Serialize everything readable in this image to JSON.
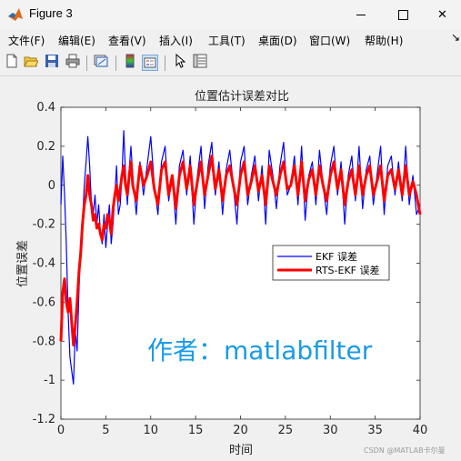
{
  "window": {
    "title": "Figure 3",
    "minimize_glyph": "—",
    "close_glyph": "✕"
  },
  "menu": {
    "items": [
      "文件(F)",
      "编辑(E)",
      "查看(V)",
      "插入(I)",
      "工具(T)",
      "桌面(D)",
      "窗口(W)",
      "帮助(H)"
    ],
    "overflow_glyph": "↘"
  },
  "toolbar": {
    "icons": [
      "new-figure-icon",
      "open-icon",
      "save-icon",
      "print-icon",
      "link-plot-icon",
      "insert-colorbar-icon",
      "insert-legend-icon",
      "edit-plot-cursor-icon",
      "property-inspector-icon"
    ]
  },
  "colors": {
    "ekf": "#0000ff",
    "rts": "#ff0000",
    "watermark": "#1a9be6"
  },
  "chart_data": {
    "type": "line",
    "title": "位置估计误差对比",
    "xlabel": "时间",
    "ylabel": "位置误差",
    "xlim": [
      0,
      40
    ],
    "ylim": [
      -1.2,
      0.4
    ],
    "xticks": [
      "0",
      "5",
      "10",
      "15",
      "20",
      "25",
      "30",
      "35",
      "40"
    ],
    "yticks": [
      "0.4",
      "0.2",
      "0",
      "-0.2",
      "-0.4",
      "-0.6",
      "-0.8",
      "-1",
      "-1.2"
    ],
    "grid": false,
    "legend_position": "right-middle",
    "series": [
      {
        "name": "EKF 误差",
        "color": "#0000ff",
        "x": [
          0,
          0.2,
          0.4,
          0.6,
          0.8,
          1.0,
          1.2,
          1.4,
          1.6,
          1.8,
          2.0,
          2.2,
          2.4,
          2.6,
          2.8,
          3.0,
          3.2,
          3.4,
          3.6,
          3.8,
          4.0,
          4.2,
          4.4,
          4.6,
          4.8,
          5.0,
          5.2,
          5.4,
          5.6,
          5.8,
          6.0,
          6.2,
          6.4,
          6.6,
          6.8,
          7.0,
          7.2,
          7.4,
          7.6,
          7.8,
          8.0,
          8.4,
          8.8,
          9.2,
          9.6,
          10.0,
          10.4,
          10.8,
          11.2,
          11.6,
          12.0,
          12.4,
          12.8,
          13.2,
          13.6,
          14.0,
          14.4,
          14.8,
          15.2,
          15.6,
          16.0,
          16.4,
          16.8,
          17.2,
          17.6,
          18.0,
          18.4,
          18.8,
          19.2,
          19.6,
          20.0,
          20.4,
          20.8,
          21.2,
          21.6,
          22.0,
          22.4,
          22.8,
          23.2,
          23.6,
          24.0,
          24.4,
          24.8,
          25.2,
          25.6,
          26.0,
          26.4,
          26.8,
          27.2,
          27.6,
          28.0,
          28.4,
          28.8,
          29.2,
          29.6,
          30.0,
          30.4,
          30.8,
          31.2,
          31.6,
          32.0,
          32.4,
          32.8,
          33.2,
          33.6,
          34.0,
          34.4,
          34.8,
          35.2,
          35.6,
          36.0,
          36.4,
          36.8,
          37.2,
          37.6,
          38.0,
          38.4,
          38.8,
          39.2,
          39.6,
          40.0
        ],
        "y": [
          -0.1,
          0.15,
          -0.05,
          -0.3,
          -0.65,
          -0.88,
          -0.95,
          -1.02,
          -0.75,
          -0.85,
          -0.55,
          -0.3,
          -0.2,
          0.0,
          0.12,
          0.25,
          0.1,
          -0.1,
          -0.15,
          -0.05,
          -0.2,
          -0.1,
          -0.25,
          -0.3,
          -0.15,
          -0.32,
          -0.2,
          -0.1,
          -0.3,
          -0.2,
          -0.05,
          0.1,
          -0.15,
          -0.1,
          0.05,
          0.28,
          0.05,
          -0.1,
          0.08,
          0.2,
          0.05,
          -0.15,
          0.12,
          -0.05,
          0.1,
          0.25,
          0.0,
          -0.15,
          0.12,
          0.2,
          -0.08,
          0.05,
          -0.2,
          0.1,
          0.18,
          -0.05,
          0.15,
          -0.2,
          0.05,
          0.2,
          -0.12,
          0.1,
          0.22,
          -0.05,
          0.12,
          -0.15,
          0.08,
          0.18,
          0.0,
          -0.2,
          0.12,
          0.2,
          -0.1,
          0.05,
          0.15,
          -0.08,
          0.1,
          -0.2,
          0.18,
          0.05,
          -0.12,
          0.1,
          0.22,
          -0.05,
          0.0,
          0.15,
          -0.1,
          0.2,
          -0.18,
          0.05,
          0.12,
          -0.1,
          0.18,
          0.0,
          -0.15,
          0.1,
          0.2,
          -0.05,
          0.12,
          -0.2,
          0.05,
          0.15,
          -0.08,
          0.2,
          -0.12,
          0.08,
          0.15,
          -0.1,
          0.05,
          0.2,
          -0.15,
          0.1,
          0.15,
          -0.05,
          0.12,
          -0.08,
          0.2,
          -0.1,
          0.05,
          -0.15,
          -0.1
        ]
      },
      {
        "name": "RTS-EKF 误差",
        "color": "#ff0000",
        "x": [
          0,
          0.2,
          0.4,
          0.6,
          0.8,
          1.0,
          1.2,
          1.4,
          1.6,
          1.8,
          2.0,
          2.2,
          2.4,
          2.6,
          2.8,
          3.0,
          3.2,
          3.4,
          3.6,
          3.8,
          4.0,
          4.2,
          4.4,
          4.6,
          4.8,
          5.0,
          5.2,
          5.4,
          5.6,
          5.8,
          6.0,
          6.2,
          6.4,
          6.6,
          6.8,
          7.0,
          7.2,
          7.4,
          7.6,
          7.8,
          8.0,
          8.4,
          8.8,
          9.2,
          9.6,
          10.0,
          10.4,
          10.8,
          11.2,
          11.6,
          12.0,
          12.4,
          12.8,
          13.2,
          13.6,
          14.0,
          14.4,
          14.8,
          15.2,
          15.6,
          16.0,
          16.4,
          16.8,
          17.2,
          17.6,
          18.0,
          18.4,
          18.8,
          19.2,
          19.6,
          20.0,
          20.4,
          20.8,
          21.2,
          21.6,
          22.0,
          22.4,
          22.8,
          23.2,
          23.6,
          24.0,
          24.4,
          24.8,
          25.2,
          25.6,
          26.0,
          26.4,
          26.8,
          27.2,
          27.6,
          28.0,
          28.4,
          28.8,
          29.2,
          29.6,
          30.0,
          30.4,
          30.8,
          31.2,
          31.6,
          32.0,
          32.4,
          32.8,
          33.2,
          33.6,
          34.0,
          34.4,
          34.8,
          35.2,
          35.6,
          36.0,
          36.4,
          36.8,
          37.2,
          37.6,
          38.0,
          38.4,
          38.8,
          39.2,
          39.6,
          40.0
        ],
        "y": [
          -0.8,
          -0.55,
          -0.48,
          -0.6,
          -0.65,
          -0.58,
          -0.7,
          -0.82,
          -0.72,
          -0.6,
          -0.45,
          -0.35,
          -0.2,
          -0.1,
          -0.05,
          0.05,
          -0.05,
          -0.1,
          -0.18,
          -0.15,
          -0.22,
          -0.2,
          -0.25,
          -0.28,
          -0.2,
          -0.22,
          -0.15,
          -0.18,
          -0.25,
          -0.12,
          -0.05,
          0.0,
          -0.08,
          -0.02,
          0.05,
          0.1,
          0.0,
          -0.05,
          0.05,
          0.12,
          0.0,
          -0.08,
          0.1,
          0.0,
          0.05,
          0.12,
          -0.02,
          -0.1,
          0.08,
          0.12,
          -0.05,
          0.05,
          -0.12,
          0.05,
          0.12,
          -0.02,
          0.1,
          -0.1,
          0.02,
          0.12,
          -0.05,
          0.05,
          0.15,
          -0.02,
          0.08,
          -0.08,
          0.05,
          0.1,
          0.0,
          -0.1,
          0.05,
          0.12,
          -0.05,
          0.02,
          0.1,
          -0.03,
          0.05,
          -0.1,
          0.1,
          0.02,
          -0.05,
          0.05,
          0.12,
          -0.02,
          0.0,
          0.1,
          -0.05,
          0.12,
          -0.08,
          0.03,
          0.08,
          -0.05,
          0.1,
          0.0,
          -0.08,
          0.05,
          0.12,
          -0.02,
          0.08,
          -0.1,
          0.02,
          0.08,
          -0.05,
          0.1,
          -0.05,
          0.05,
          0.1,
          -0.05,
          0.02,
          0.1,
          -0.08,
          0.05,
          0.08,
          -0.02,
          0.08,
          -0.05,
          0.1,
          -0.05,
          0.02,
          -0.05,
          -0.15
        ]
      }
    ]
  },
  "watermark_text": "作者：matlabfilter",
  "csdn_watermark": "CSDN @MATLAB卡尔曼"
}
